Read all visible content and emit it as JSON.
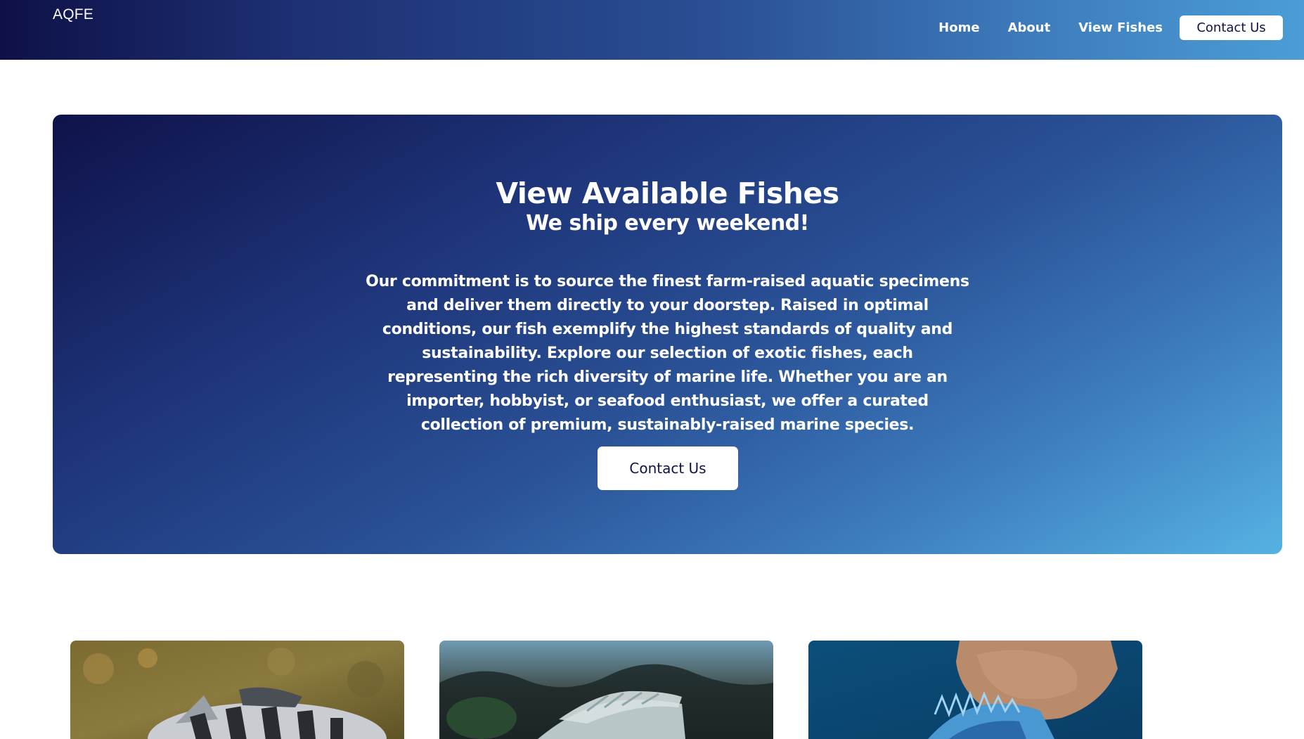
{
  "brand": {
    "name": "AQFE"
  },
  "nav": {
    "links": [
      {
        "label": "Home"
      },
      {
        "label": "About"
      },
      {
        "label": "View Fishes"
      }
    ],
    "cta_label": "Contact Us"
  },
  "hero": {
    "title": "View Available Fishes",
    "subtitle": "We ship every weekend!",
    "description": "Our commitment is to source the finest farm-raised aquatic specimens and deliver them directly to your doorstep. Raised in optimal conditions, our fish exemplify the highest standards of quality and sustainability. Explore our selection of exotic fishes, each representing the rich diversity of marine life. Whether you are an importer, hobbyist, or seafood enthusiast, we offer a curated collection of premium, sustainably-raised marine species.",
    "cta_label": "Contact Us"
  },
  "colors": {
    "accent_dark": "#0e1147",
    "accent_light": "#56b2e3",
    "button_text": "#0e1347"
  },
  "fish_cards": [
    {
      "image": "fish-photo-striped-cichlid"
    },
    {
      "image": "fish-photo-silver-cichlid"
    },
    {
      "image": "fish-photo-blue-cichlid"
    }
  ]
}
